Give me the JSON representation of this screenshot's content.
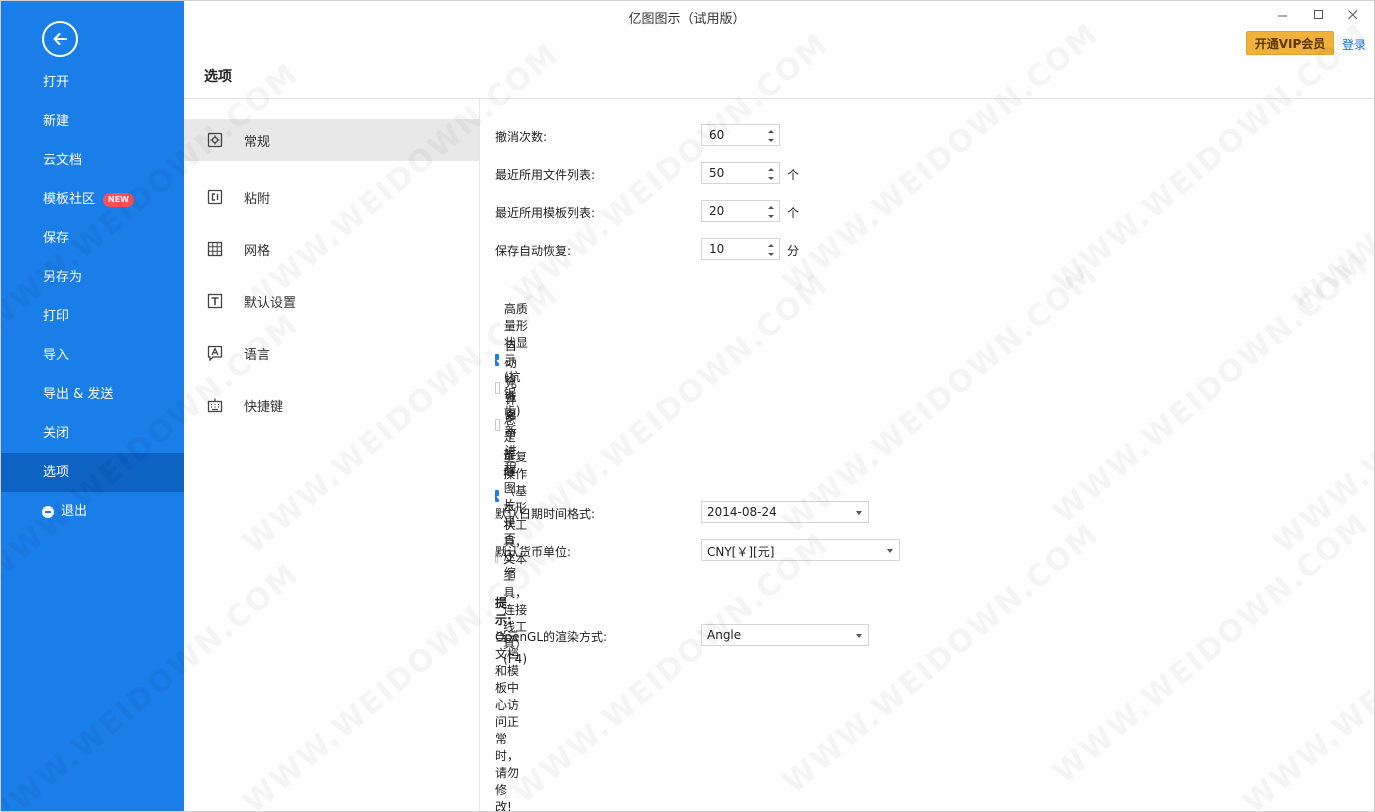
{
  "window": {
    "title": "亿图图示（试用版）",
    "vip_button": "开通VIP会员",
    "login_link": "登录"
  },
  "sidebar": {
    "items": [
      {
        "label": "打开"
      },
      {
        "label": "新建"
      },
      {
        "label": "云文档"
      },
      {
        "label": "模板社区",
        "badge": "NEW"
      },
      {
        "label": "保存"
      },
      {
        "label": "另存为"
      },
      {
        "label": "打印"
      },
      {
        "label": "导入"
      },
      {
        "label": "导出 & 发送"
      },
      {
        "label": "关闭"
      },
      {
        "label": "选项"
      },
      {
        "label": "退出"
      }
    ]
  },
  "page": {
    "title": "选项"
  },
  "categories": [
    {
      "label": "常规",
      "icon": "gear-icon"
    },
    {
      "label": "粘附",
      "icon": "snap-icon"
    },
    {
      "label": "网格",
      "icon": "grid-icon"
    },
    {
      "label": "默认设置",
      "icon": "text-icon"
    },
    {
      "label": "语言",
      "icon": "language-icon"
    },
    {
      "label": "快捷键",
      "icon": "keyboard-icon"
    }
  ],
  "general": {
    "undo_label": "撤消次数:",
    "undo_value": "60",
    "recent_files_label": "最近所用文件列表:",
    "recent_files_value": "50",
    "recent_files_unit": "个",
    "recent_templates_label": "最近所用模板列表:",
    "recent_templates_value": "20",
    "recent_templates_unit": "个",
    "autosave_label": "保存自动恢复:",
    "autosave_value": "10",
    "autosave_unit": "分",
    "checkboxes": [
      {
        "label": "高质量形状显示 (抗锯齿)",
        "checked": true
      },
      {
        "label": "自动检查更新",
        "checked": false
      },
      {
        "label": "允许多个进程",
        "checked": false
      },
      {
        "label": "总是提醒图片是否压缩",
        "checked": true
      },
      {
        "label": "重复操作（基本形状工具，文本工具，连接线工具）(F4)",
        "checked": false
      }
    ],
    "date_format_label": "默认日期时间格式:",
    "date_format_value": "2014-08-24",
    "currency_label": "默认货币单位:",
    "currency_value": "CNY[￥][元]",
    "hint_prefix": "提示:",
    "hint_text": "当云文档和模板中心访问正常时，请勿修改!",
    "opengl_label": "OpenGL的渲染方式:",
    "opengl_value": "Angle"
  },
  "colors": {
    "sidebar_bg": "#1a7ee8",
    "sidebar_active": "#0d62c2",
    "vip_gold": "#f1b13b",
    "checkbox_blue": "#1a7ee8",
    "badge_red": "#ff4d5a"
  },
  "watermark": "WWW.WEIDOWN.COM"
}
